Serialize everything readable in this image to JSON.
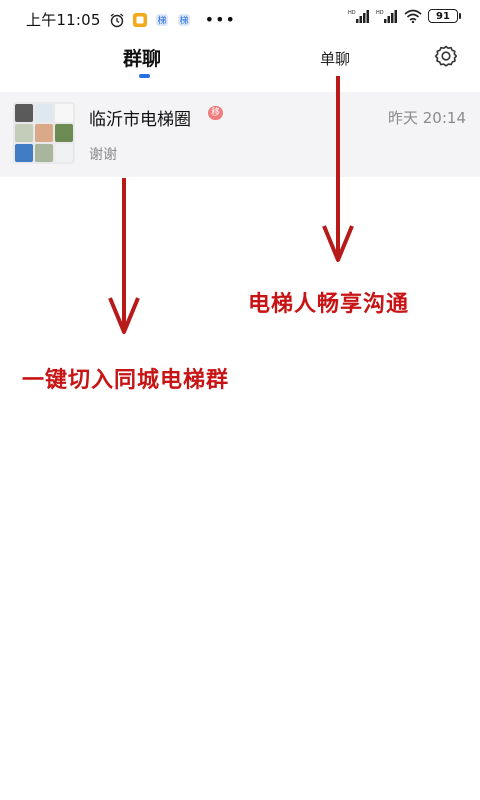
{
  "status_bar": {
    "time": "上午11:05",
    "battery": "91"
  },
  "tabs": {
    "group": "群聊",
    "single": "单聊"
  },
  "chat_list": [
    {
      "name": "临沂市电梯圈",
      "tag": "移",
      "time": "昨天 20:14",
      "preview": "谢谢"
    }
  ],
  "annotations": {
    "right": "电梯人畅享沟通",
    "left": "一键切入同城电梯群"
  },
  "colors": {
    "accent": "#2a6fe0",
    "annotation": "#c81414",
    "row_background": "#f4f4f6",
    "muted_text": "#8a8a8e"
  }
}
